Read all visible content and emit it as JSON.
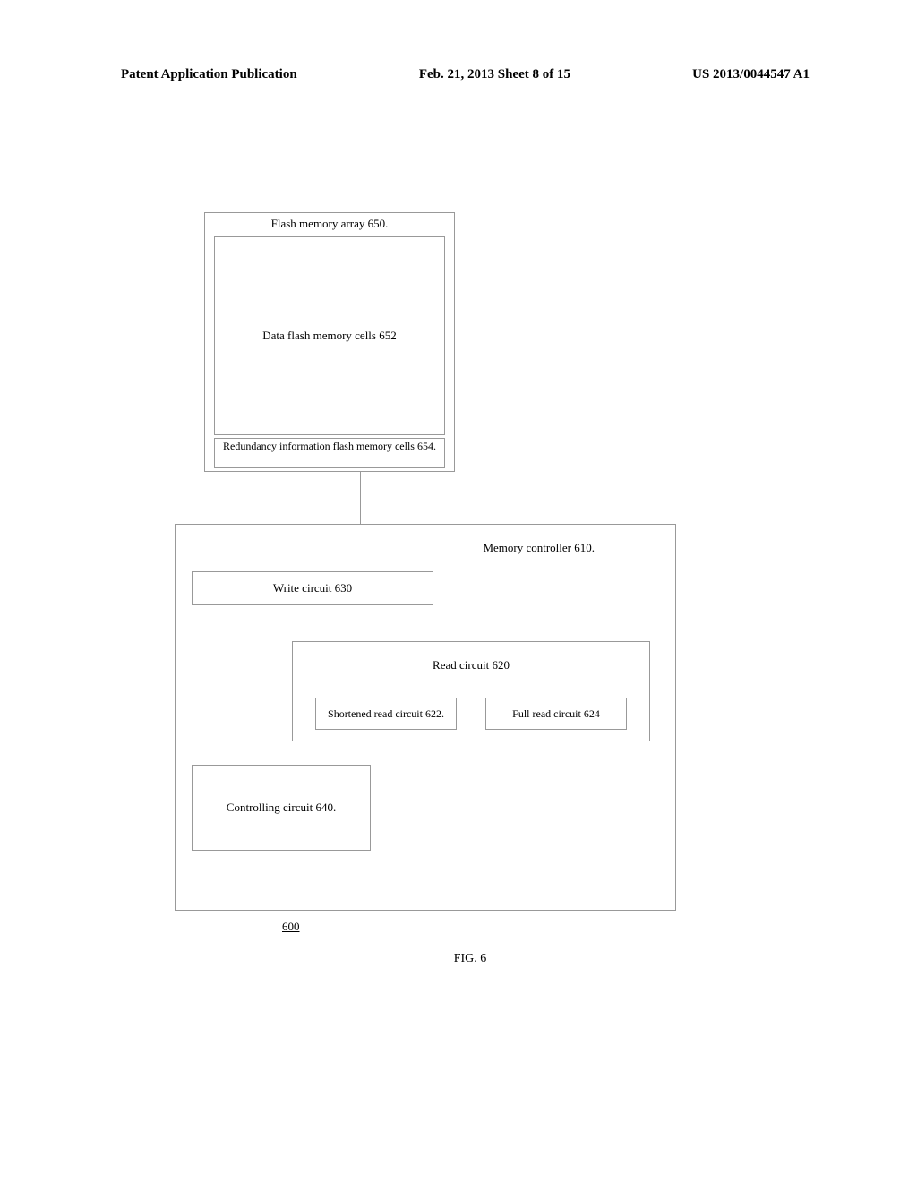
{
  "header": {
    "left": "Patent Application Publication",
    "center": "Feb. 21, 2013  Sheet 8 of 15",
    "right": "US 2013/0044547 A1"
  },
  "flash_array_title": "Flash memory array 650.",
  "data_cells_label": "Data flash memory cells 652",
  "redundancy_cells_label": "Redundancy information flash memory cells 654.",
  "controller_title": "Memory controller 610.",
  "write_circuit_label": "Write circuit 630",
  "read_circuit_label": "Read circuit 620",
  "shortened_read_label": "Shortened read circuit 622.",
  "full_read_label": "Full read circuit 624",
  "controlling_circuit_label": "Controlling circuit 640.",
  "ref_number": "600",
  "figure_label": "FIG. 6"
}
